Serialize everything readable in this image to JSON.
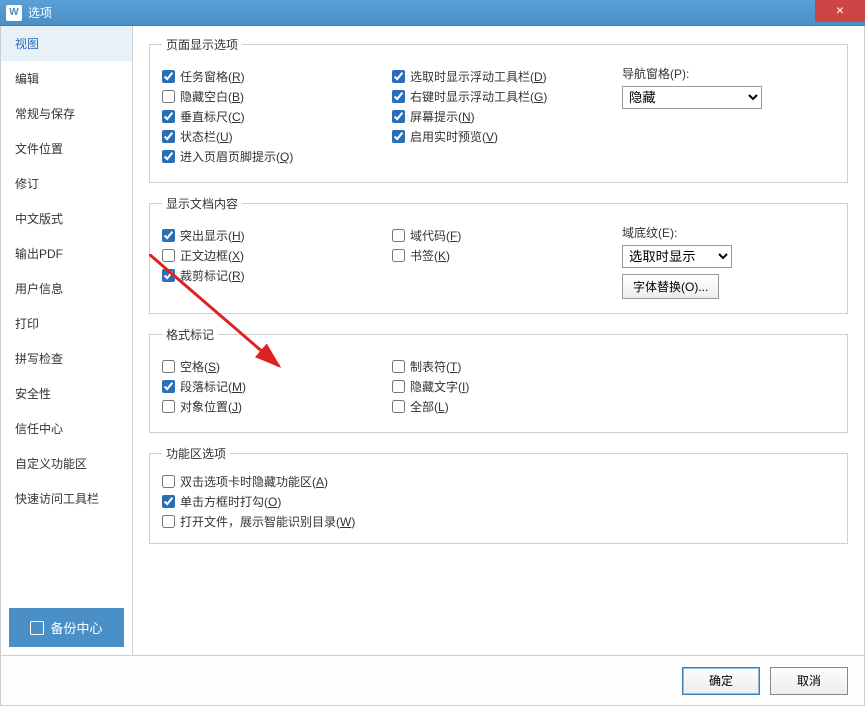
{
  "window": {
    "title": "选项",
    "icon_letter": "W"
  },
  "close_label": "×",
  "sidebar": {
    "items": [
      {
        "label": "视图",
        "active": true
      },
      {
        "label": "编辑"
      },
      {
        "label": "常规与保存"
      },
      {
        "label": "文件位置"
      },
      {
        "label": "修订"
      },
      {
        "label": "中文版式"
      },
      {
        "label": "输出PDF"
      },
      {
        "label": "用户信息"
      },
      {
        "label": "打印"
      },
      {
        "label": "拼写检查"
      },
      {
        "label": "安全性"
      },
      {
        "label": "信任中心"
      },
      {
        "label": "自定义功能区"
      },
      {
        "label": "快速访问工具栏"
      }
    ],
    "backup_label": "备份中心"
  },
  "groups": {
    "page_display": {
      "legend": "页面显示选项",
      "items_col1": [
        {
          "label": "任务窗格(R)",
          "checked": true,
          "key": "R"
        },
        {
          "label": "隐藏空白(B)",
          "checked": false,
          "key": "B"
        },
        {
          "label": "垂直标尺(C)",
          "checked": true,
          "key": "C"
        },
        {
          "label": "状态栏(U)",
          "checked": true,
          "key": "U"
        },
        {
          "label": "进入页眉页脚提示(Q)",
          "checked": true,
          "key": "Q"
        }
      ],
      "items_col2": [
        {
          "label": "选取时显示浮动工具栏(D)",
          "checked": true,
          "key": "D"
        },
        {
          "label": "右键时显示浮动工具栏(G)",
          "checked": true,
          "key": "G"
        },
        {
          "label": "屏幕提示(N)",
          "checked": true,
          "key": "N"
        },
        {
          "label": "启用实时预览(V)",
          "checked": true,
          "key": "V"
        }
      ],
      "nav_label": "导航窗格(P):",
      "nav_value": "隐藏"
    },
    "doc_content": {
      "legend": "显示文档内容",
      "items_col1": [
        {
          "label": "突出显示(H)",
          "checked": true,
          "key": "H"
        },
        {
          "label": "正文边框(X)",
          "checked": false,
          "key": "X"
        },
        {
          "label": "裁剪标记(R)",
          "checked": true,
          "key": "R"
        }
      ],
      "items_col2": [
        {
          "label": "域代码(F)",
          "checked": false,
          "key": "F"
        },
        {
          "label": "书签(K)",
          "checked": false,
          "key": "K"
        }
      ],
      "shade_label": "域底纹(E):",
      "shade_value": "选取时显示",
      "font_btn": "字体替换(O)..."
    },
    "format_marks": {
      "legend": "格式标记",
      "items_col1": [
        {
          "label": "空格(S)",
          "checked": false,
          "key": "S"
        },
        {
          "label": "段落标记(M)",
          "checked": true,
          "key": "M"
        },
        {
          "label": "对象位置(J)",
          "checked": false,
          "key": "J"
        }
      ],
      "items_col2": [
        {
          "label": "制表符(T)",
          "checked": false,
          "key": "T"
        },
        {
          "label": "隐藏文字(I)",
          "checked": false,
          "key": "I"
        },
        {
          "label": "全部(L)",
          "checked": false,
          "key": "L"
        }
      ]
    },
    "ribbon": {
      "legend": "功能区选项",
      "items": [
        {
          "label": "双击选项卡时隐藏功能区(A)",
          "checked": false,
          "key": "A"
        },
        {
          "label": "单击方框时打勾(O)",
          "checked": true,
          "key": "O"
        },
        {
          "label": "打开文件，展示智能识别目录(W)",
          "checked": false,
          "key": "W"
        }
      ]
    }
  },
  "footer": {
    "ok": "确定",
    "cancel": "取消"
  }
}
